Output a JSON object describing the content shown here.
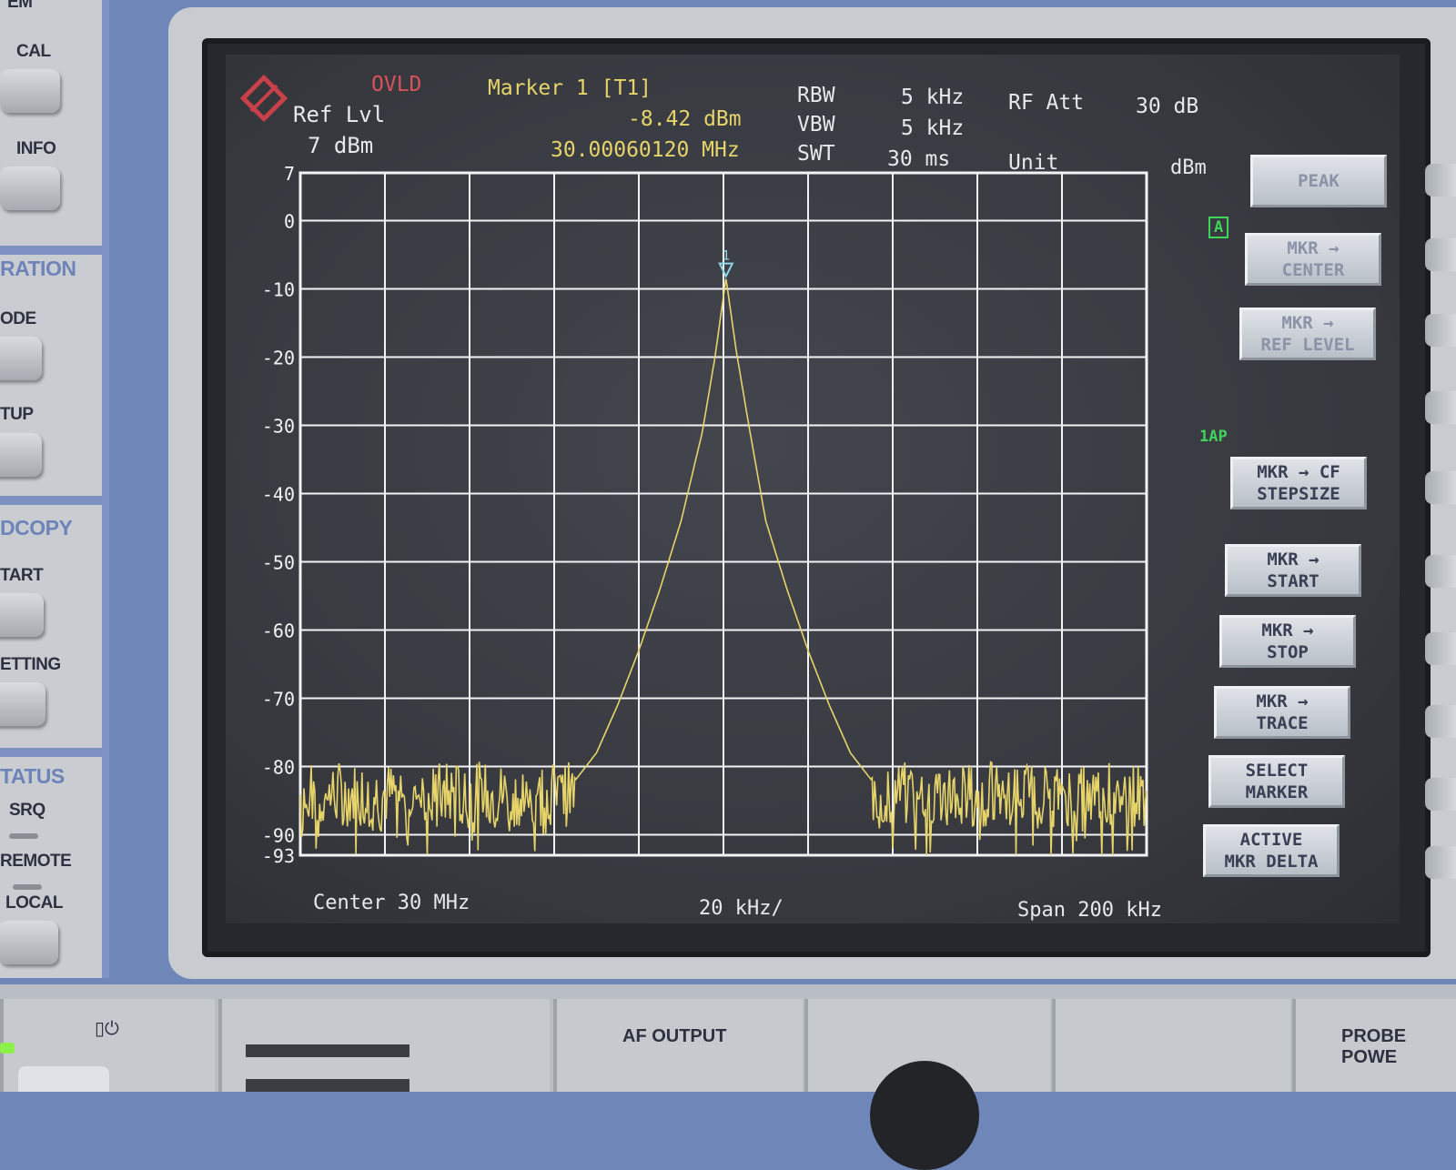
{
  "left_panel": {
    "top_cut": "EM",
    "cal": "CAL",
    "info": "INFO",
    "section_calibration": "RATION",
    "mode": "ODE",
    "setup": "TUP",
    "section_hardcopy": "DCOPY",
    "start": "TART",
    "setting": "ETTING",
    "section_status": "TATUS",
    "srq": "SRQ",
    "remote": "REMOTE",
    "local": "LOCAL"
  },
  "header": {
    "ovld": "OVLD",
    "ref_lvl_label": "Ref Lvl",
    "ref_lvl_value": "7 dBm",
    "marker_title": "Marker 1 [T1]",
    "marker_level": "-8.42 dBm",
    "marker_freq": "30.00060120 MHz",
    "rbw_label": "RBW",
    "rbw_value": "5 kHz",
    "vbw_label": "VBW",
    "vbw_value": "5 kHz",
    "swt_label": "SWT",
    "swt_value": "30 ms",
    "rf_att_label": "RF Att",
    "rf_att_value": "30 dB",
    "unit_label": "Unit",
    "unit_value": "dBm"
  },
  "indicators": {
    "trace_a": "A",
    "trace_1ap": "1AP"
  },
  "footer": {
    "center": "Center 30 MHz",
    "div": "20 kHz/",
    "span": "Span 200 kHz"
  },
  "softkeys": [
    {
      "label": "PEAK",
      "enabled": false
    },
    {
      "label": "MKR →\nCENTER",
      "enabled": false
    },
    {
      "label": "MKR →\nREF LEVEL",
      "enabled": false
    },
    {
      "label": "MKR → CF\nSTEPSIZE",
      "enabled": true
    },
    {
      "label": "MKR →\nSTART",
      "enabled": true
    },
    {
      "label": "MKR →\nSTOP",
      "enabled": true
    },
    {
      "label": "MKR →\nTRACE",
      "enabled": true
    },
    {
      "label": "SELECT\nMARKER",
      "enabled": true
    },
    {
      "label": "ACTIVE\nMKR DELTA",
      "enabled": true
    }
  ],
  "bottom_panel": {
    "af_output": "AF OUTPUT",
    "probe_power": "PROBE POWE"
  },
  "colors": {
    "trace": "#e6d46a",
    "grid": "#f2f3f5",
    "ovld": "#d8525a",
    "indicator": "#3fd45a",
    "panel_blue": "#6f86b8"
  },
  "chart_data": {
    "type": "line",
    "xlabel": "",
    "ylabel": "",
    "x_unit": "MHz",
    "y_unit": "dBm",
    "xlim": [
      29.9,
      30.1
    ],
    "ylim": [
      -93,
      7
    ],
    "y_ticks": [
      7,
      0,
      -10,
      -20,
      -30,
      -40,
      -50,
      -60,
      -70,
      -80,
      -90,
      -93
    ],
    "series": [
      {
        "x": [
          29.9,
          29.92,
          29.94,
          29.96,
          29.965,
          29.97,
          29.975,
          29.98,
          29.985,
          29.99,
          29.995,
          29.998,
          30.0006,
          30.003,
          30.006,
          30.01,
          30.015,
          30.02,
          30.025,
          30.03,
          30.035,
          30.04,
          30.06,
          30.08,
          30.1
        ],
        "y": [
          -84,
          -84,
          -84,
          -84,
          -82,
          -78,
          -71,
          -63,
          -54,
          -44,
          -31,
          -20,
          -8.42,
          -19,
          -30,
          -44,
          -54,
          -63,
          -71,
          -78,
          -82,
          -84,
          -84,
          -84,
          -84
        ]
      }
    ],
    "marker": {
      "label": "1",
      "x": 30.0006,
      "y": -8.42
    },
    "noise_floor": {
      "mean": -85,
      "spread": 6
    }
  }
}
